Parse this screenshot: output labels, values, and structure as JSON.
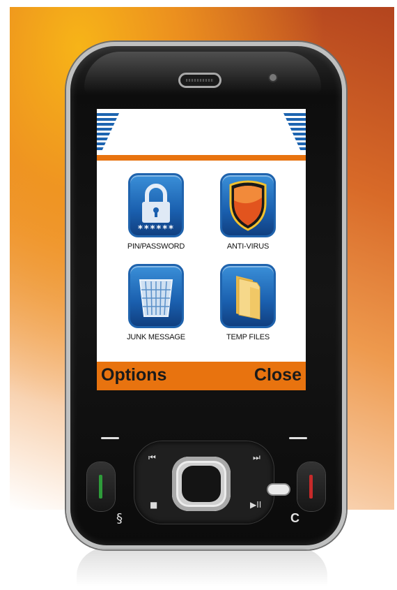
{
  "screen": {
    "apps": [
      {
        "label": "PIN/PASSWORD",
        "icon": "padlock-icon",
        "pin_mask": "******"
      },
      {
        "label": "ANTI-VIRUS",
        "icon": "shield-icon"
      },
      {
        "label": "JUNK MESSAGE",
        "icon": "wastebasket-icon"
      },
      {
        "label": "TEMP FILES",
        "icon": "folder-icon"
      }
    ],
    "softkeys": {
      "left": "Options",
      "right": "Close"
    }
  },
  "keypad": {
    "prev_icon": "⏮",
    "next_icon": "⏭",
    "stop_icon": "■",
    "play_pause_icon": "▶II",
    "clear_key": "C",
    "menu_key": "§"
  },
  "colors": {
    "accent_orange": "#e8730f",
    "tile_blue": "#1a5fae",
    "softkey_text": "#1a1a1a"
  }
}
